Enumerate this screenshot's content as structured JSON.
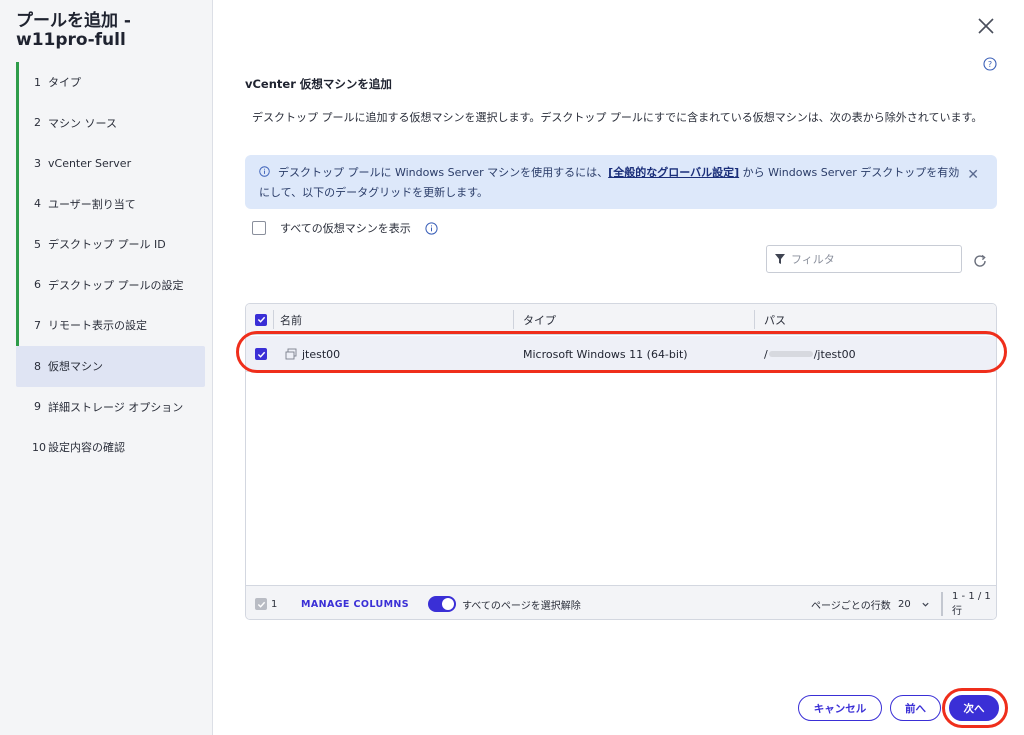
{
  "sidebar": {
    "title": "プールを追加 - w11pro-full",
    "steps": [
      {
        "num": "1",
        "label": "タイプ"
      },
      {
        "num": "2",
        "label": "マシン ソース"
      },
      {
        "num": "3",
        "label": "vCenter Server"
      },
      {
        "num": "4",
        "label": "ユーザー割り当て"
      },
      {
        "num": "5",
        "label": "デスクトップ プール ID"
      },
      {
        "num": "6",
        "label": "デスクトップ プールの設定"
      },
      {
        "num": "7",
        "label": "リモート表示の設定"
      },
      {
        "num": "8",
        "label": "仮想マシン"
      },
      {
        "num": "9",
        "label": "詳細ストレージ オプション"
      },
      {
        "num": "10",
        "label": "設定内容の確認"
      }
    ],
    "active_step": "8"
  },
  "main": {
    "title": "vCenter 仮想マシンを追加",
    "description": "デスクトップ プールに追加する仮想マシンを選択します。デスクトップ プールにすでに含まれている仮想マシンは、次の表から除外されています。",
    "banner": {
      "text_before": "デスクトップ プールに Windows Server マシンを使用するには、",
      "link": "[全般的なグローバル設定]",
      "text_after": " から Windows Server デスクトップを有効にして、以下のデータグリッドを更新します。"
    },
    "show_all_label": "すべての仮想マシンを表示",
    "show_all_checked": false,
    "filter_placeholder": "フィルタ"
  },
  "grid": {
    "columns": [
      "名前",
      "タイプ",
      "パス"
    ],
    "rows": [
      {
        "name": "jtest00",
        "type": "Microsoft Windows 11 (64-bit)",
        "path_prefix": "/",
        "path_suffix": "/jtest00",
        "selected": true
      }
    ],
    "footer": {
      "selected_count": "1",
      "manage_columns": "MANAGE COLUMNS",
      "toggle_label": "すべてのページを選択解除",
      "toggle_on": true,
      "rows_per_page_label": "ページごとの行数",
      "rows_per_page": "20",
      "range": "1 - 1 / 1 行"
    }
  },
  "buttons": {
    "cancel": "キャンセル",
    "back": "前へ",
    "next": "次へ"
  },
  "colors": {
    "accent": "#3a2fd6",
    "step_done": "#2e9c4a",
    "highlight": "#ef2e1b",
    "banner_bg": "#dde8fa"
  }
}
